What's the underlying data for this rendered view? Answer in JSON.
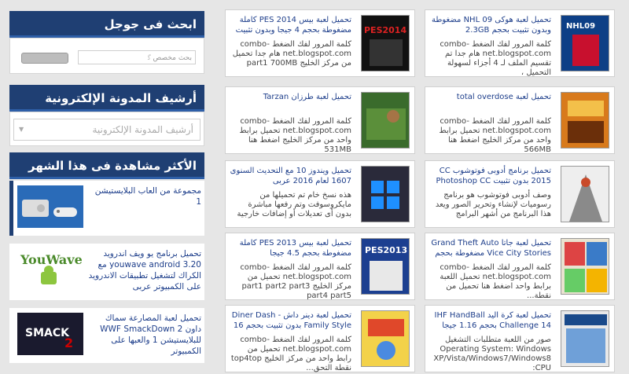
{
  "sidebar": {
    "search": {
      "heading": "ابحث فى جوجل",
      "placeholder": "بحث مخصص",
      "search_logo": "Google search box"
    },
    "archive": {
      "heading": "أرشيف المدونة الإلكترونية",
      "select_value": "أرشيف المدونة الإلكترونية"
    },
    "popular": {
      "heading": "الأكثر مشاهدة فى هذا الشهر",
      "items": [
        {
          "title": "مجموعة من العاب البلايستيشن 1"
        },
        {
          "title": "تحميل برنامج يو ويف اندرويد 3.20 youwave android مع الكراك لتشغيل تطبيقات الاندرويد على الكمبيوتر عربى",
          "logo_text": "YouWave"
        },
        {
          "title": "تحميل لعبة المصارعة سماك داون 2 WWF SmackDown للبلايستيشن 1 والعبها على الكمبيوتر"
        }
      ]
    }
  },
  "posts": [
    {
      "title": "تحميل لعبة هوكى NHL 09 مضغوطة وبدون تثبيت بحجم 2.3GB",
      "snippet": "كلمة المرور لفك الضغط combo-net.blogspot.com هام جدا تم تقسيم الملف لـ 4 أجزاء لسهولة التحميل ،",
      "thumb_text": "NHL09"
    },
    {
      "title": "تحميل لعبة بيس PES 2014 كاملة مضغوطة بحجم 4 جيجا وبدون تثبيت",
      "snippet": "كلمة المرور لفك الضغط combo-net.blogspot.com هام جدا تحميل من مركز الخليج part1 700MB",
      "thumb_text": "PES2014"
    },
    {
      "title": "تحميل لعبة total overdose",
      "snippet": "كلمة المرور لفك الضغط combo-net.blogspot.com تحميل برابط واحد من مركز الخليج اضغط هنا 566MB",
      "thumb_text": ""
    },
    {
      "title": "تحميل لعبة طرزان Tarzan",
      "snippet": "كلمة المرور لفك الضغط combo-net.blogspot.com تحميل برابط واحد من مركز الخليج اضغط هنا 531MB",
      "thumb_text": ""
    },
    {
      "title": "تحميل برنامج أدوبى فوتوشوب CC 2015 بدون تثبيت Photoshop CC",
      "snippet": "وصف أدوبى فوتوشوب هو برنامج رسوميات لإنشاء وتحرير الصور ويعد هذا البرنامج من أشهر البرامج",
      "thumb_text": ""
    },
    {
      "title": "تحميل ويندوز 10 مع التحديث السنوى 1607 لعام 2016 عربى",
      "snippet": "هذه نسخ خام تم تحميلها من مايكروسوفت وتم رفعها مباشرة بدون أى تعديلات أو إضافات خارجية",
      "thumb_text": "Windows 10"
    },
    {
      "title": "تحميل لعبة جاتا Grand Theft Auto Vice City Stories مضغوطة بحجم",
      "snippet": "كلمة المرور لفك الضغط combo-net.blogspot.com تحميل اللعبة برابط واحد اضغط هنا تحميل من نقطة...",
      "thumb_text": "GTA"
    },
    {
      "title": "تحميل لعبة بيس PES 2013 كاملة مضغوطة بحجم 4.5 جيجا",
      "snippet": "كلمة المرور لفك الضغط combo-net.blogspot.com تحميل من مركز الخليج part1 part2 part3 part4 part5",
      "thumb_text": "PES2013"
    },
    {
      "title": "تحميل لعبة كرة اليد IHF HandBall Challenge 14 بحجم 1.16 جيجا",
      "snippet": "صور من اللعبة متطلبات التشغيل Operating System: Windows XP/Vista/Windows7/Windows8 CPU:",
      "thumb_text": "HANDBALL"
    },
    {
      "title": "تحميل لعبة دينر داش - Diner Dash Family Style بدون تثبيت بحجم 16",
      "snippet": "كلمة المرور لفك الضغط combo-net.blogspot.com تحميل من رابط واحد من مركز الخليج top4top نقطة التحق...",
      "thumb_text": "Diner Dash"
    }
  ]
}
